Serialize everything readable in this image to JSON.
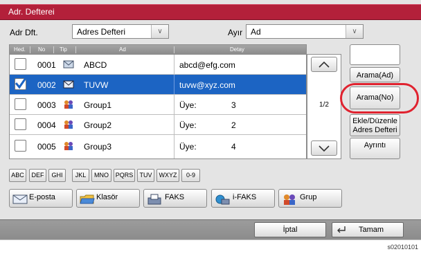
{
  "title": "Adr. Defterei",
  "toolbar": {
    "source_label": "Adr Dft.",
    "source_value": "Adres Defteri",
    "sort_label": "Ayır",
    "sort_value": "Ad"
  },
  "table": {
    "headers": {
      "check": "Hed.",
      "no": "No",
      "type": "Tip",
      "name": "Ad",
      "detail": "Detay"
    },
    "rows": [
      {
        "no": "0001",
        "type": "email",
        "name": "ABCD",
        "detail": "abcd@efg.com",
        "value": "",
        "selected": false
      },
      {
        "no": "0002",
        "type": "email",
        "name": "TUVW",
        "detail": "tuvw@xyz.com",
        "value": "",
        "selected": true
      },
      {
        "no": "0003",
        "type": "group",
        "name": "Group1",
        "detail": "Üye:",
        "value": "3",
        "selected": false
      },
      {
        "no": "0004",
        "type": "group",
        "name": "Group2",
        "detail": "Üye:",
        "value": "2",
        "selected": false
      },
      {
        "no": "0005",
        "type": "group",
        "name": "Group3",
        "detail": "Üye:",
        "value": "4",
        "selected": false
      }
    ],
    "page": "1/2"
  },
  "side": {
    "search_name": "Arama(Ad)",
    "search_no": "Arama(No)",
    "edit_line1": "Ekle/Düzenle",
    "edit_line2": "Adres Defteri",
    "detail": "Ayrıntı"
  },
  "alphabet": [
    "ABC",
    "DEF",
    "GHI",
    "JKL",
    "MNO",
    "PQRS",
    "TUV",
    "WXYZ",
    "0-9"
  ],
  "types": {
    "email": "E-posta",
    "folder": "Klasör",
    "fax": "FAKS",
    "ifax": "i-FAKS",
    "group": "Grup"
  },
  "bottom": {
    "cancel": "İptal",
    "ok": "Tamam"
  },
  "figure_code": "s02010101",
  "colors": {
    "titlebar": "#b3203a",
    "selection": "#1c64c3",
    "highlight_ring": "#e0222f"
  },
  "icons": {
    "arrow_up": "chevron-up-icon",
    "arrow_down": "chevron-down-icon",
    "enter": "enter-icon"
  }
}
